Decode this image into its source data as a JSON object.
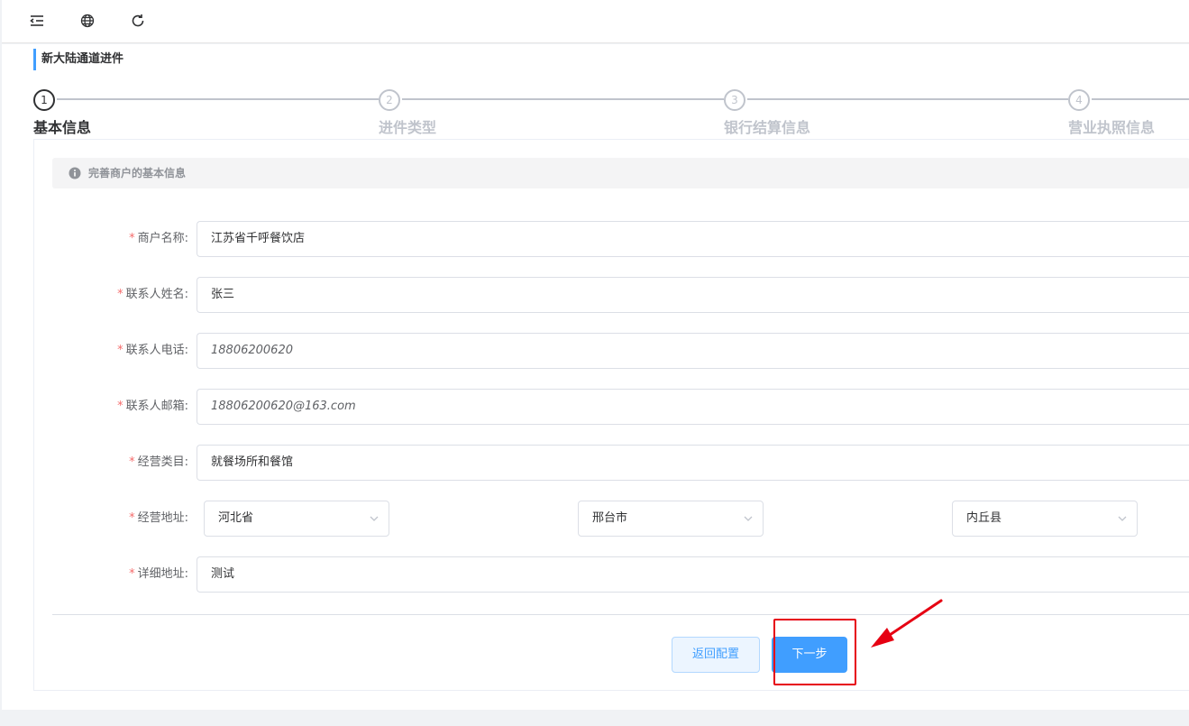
{
  "header": {
    "icons": [
      "menu-fold-icon",
      "globe-icon",
      "refresh-icon"
    ]
  },
  "page": {
    "title": "新大陆通道进件"
  },
  "steps": [
    {
      "number": "1",
      "title": "基本信息",
      "active": true
    },
    {
      "number": "2",
      "title": "进件类型",
      "active": false
    },
    {
      "number": "3",
      "title": "银行结算信息",
      "active": false
    },
    {
      "number": "4",
      "title": "营业执照信息",
      "active": false
    }
  ],
  "alert": {
    "icon": "info-icon",
    "text": "完善商户的基本信息"
  },
  "form": {
    "required_mark": "*",
    "merchant_name": {
      "label": "商户名称:",
      "value": "江苏省千呼餐饮店"
    },
    "contact_name": {
      "label": "联系人姓名:",
      "value": "张三"
    },
    "contact_phone": {
      "label": "联系人电话:",
      "value": "18806200620"
    },
    "contact_email": {
      "label": "联系人邮箱:",
      "value": "18806200620@163.com"
    },
    "business_category": {
      "label": "经营类目:",
      "value": "就餐场所和餐馆"
    },
    "business_address": {
      "label": "经营地址:",
      "province": "河北省",
      "city": "邢台市",
      "district": "内丘县"
    },
    "detail_address": {
      "label": "详细地址:",
      "value": "测试"
    }
  },
  "buttons": {
    "back_label": "返回配置",
    "next_label": "下一步"
  },
  "colors": {
    "primary": "#409eff",
    "required": "#f56c6c",
    "annotation": "#e60012"
  }
}
